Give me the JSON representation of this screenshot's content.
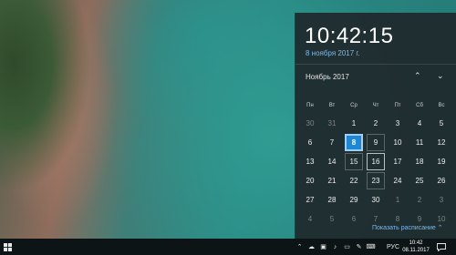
{
  "flyout": {
    "time": "10:42:15",
    "date_long": "8 ноября 2017 г.",
    "month_title": "Ноябрь 2017",
    "weekdays": [
      "Пн",
      "Вт",
      "Ср",
      "Чт",
      "Пт",
      "Сб",
      "Вс"
    ],
    "days": [
      {
        "d": "30",
        "dim": true
      },
      {
        "d": "31",
        "dim": true
      },
      {
        "d": "1"
      },
      {
        "d": "2"
      },
      {
        "d": "3"
      },
      {
        "d": "4"
      },
      {
        "d": "5"
      },
      {
        "d": "6"
      },
      {
        "d": "7"
      },
      {
        "d": "8",
        "today": true
      },
      {
        "d": "9",
        "outline": "dim"
      },
      {
        "d": "10"
      },
      {
        "d": "11"
      },
      {
        "d": "12"
      },
      {
        "d": "13"
      },
      {
        "d": "14"
      },
      {
        "d": "15",
        "outline": "dim"
      },
      {
        "d": "16",
        "outline": "light"
      },
      {
        "d": "17"
      },
      {
        "d": "18"
      },
      {
        "d": "19"
      },
      {
        "d": "20"
      },
      {
        "d": "21"
      },
      {
        "d": "22"
      },
      {
        "d": "23",
        "outline": "dim"
      },
      {
        "d": "24"
      },
      {
        "d": "25"
      },
      {
        "d": "26"
      },
      {
        "d": "27"
      },
      {
        "d": "28"
      },
      {
        "d": "29"
      },
      {
        "d": "30"
      },
      {
        "d": "1",
        "dim": true
      },
      {
        "d": "2",
        "dim": true
      },
      {
        "d": "3",
        "dim": true
      },
      {
        "d": "4",
        "dim": true
      },
      {
        "d": "5",
        "dim": true
      },
      {
        "d": "6",
        "dim": true
      },
      {
        "d": "7",
        "dim": true
      },
      {
        "d": "8",
        "dim": true
      },
      {
        "d": "9",
        "dim": true
      },
      {
        "d": "10",
        "dim": true
      }
    ],
    "show_schedule": "Показать расписание"
  },
  "taskbar": {
    "language": "РУС",
    "clock_time": "10:42",
    "clock_date": "08.11.2017",
    "tray_icons": [
      "chevron-up-icon",
      "onedrive-icon",
      "network-icon",
      "volume-icon",
      "battery-icon",
      "pen-icon",
      "keyboard-icon"
    ]
  }
}
